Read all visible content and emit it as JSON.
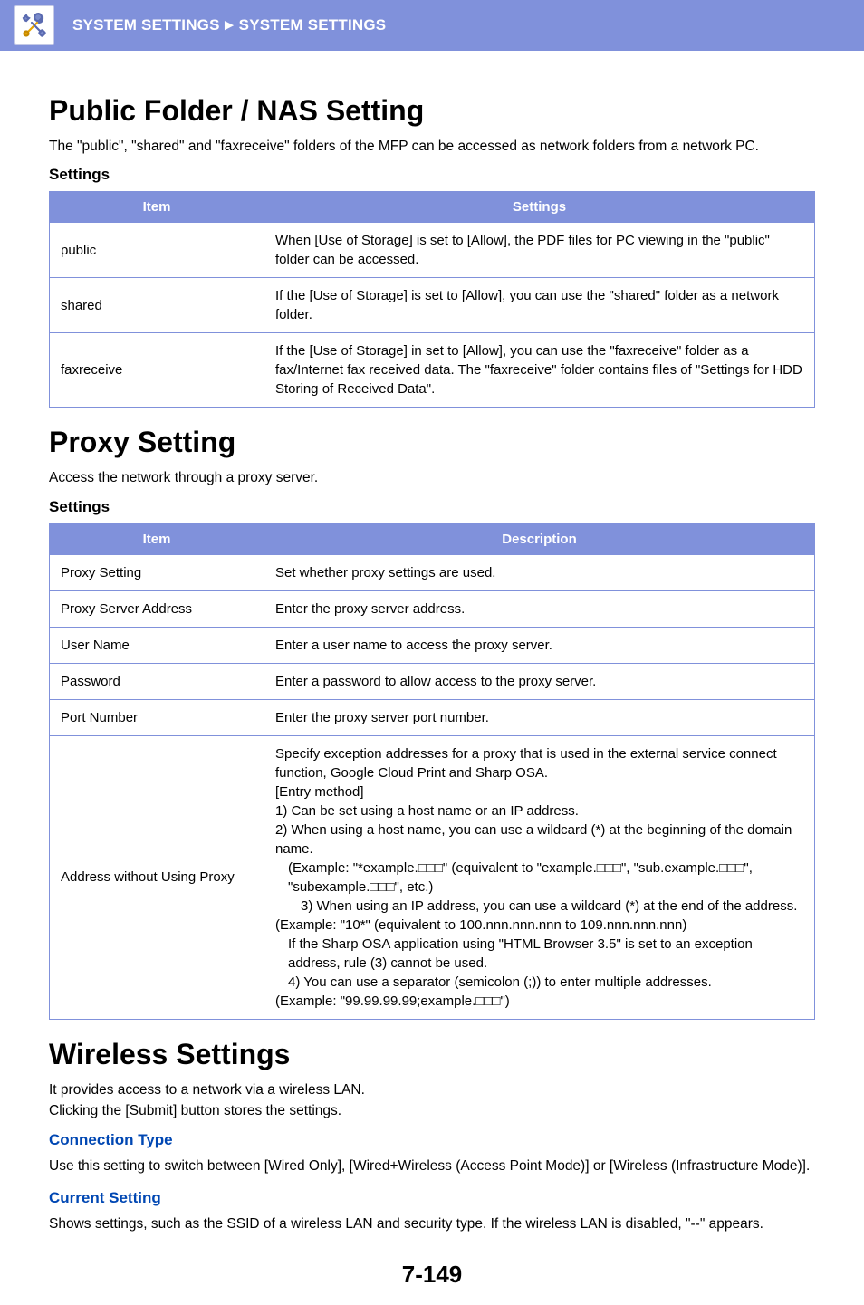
{
  "header": {
    "breadcrumb1": "SYSTEM SETTINGS",
    "sep": "►",
    "breadcrumb2": "SYSTEM SETTINGS"
  },
  "section1": {
    "title": "Public Folder / NAS Setting",
    "intro": "The \"public\", \"shared\" and \"faxreceive\" folders of the MFP can be accessed as network folders from a network PC.",
    "subhead": "Settings",
    "table": {
      "col1": "Item",
      "col2": "Settings",
      "rows": [
        {
          "item": "public",
          "desc": "When [Use of Storage] is set to [Allow], the PDF files for PC viewing in the \"public\" folder can be accessed."
        },
        {
          "item": "shared",
          "desc": "If the [Use of Storage] is set to [Allow], you can use the \"shared\" folder as a network folder."
        },
        {
          "item": "faxreceive",
          "desc": "If the [Use of Storage] in set to [Allow], you can use the \"faxreceive\" folder as a fax/Internet fax received data. The \"faxreceive\" folder contains files of \"Settings for HDD Storing of Received Data\"."
        }
      ]
    }
  },
  "section2": {
    "title": "Proxy Setting",
    "intro": "Access the network through a proxy server.",
    "subhead": "Settings",
    "table": {
      "col1": "Item",
      "col2": "Description",
      "rows": [
        {
          "item": "Proxy Setting",
          "desc_lines": [
            "Set whether proxy settings are used."
          ]
        },
        {
          "item": "Proxy Server Address",
          "desc_lines": [
            "Enter the proxy server address."
          ]
        },
        {
          "item": "User Name",
          "desc_lines": [
            "Enter a user name to access the proxy server."
          ]
        },
        {
          "item": "Password",
          "desc_lines": [
            "Enter a password to allow access to the proxy server."
          ]
        },
        {
          "item": "Port Number",
          "desc_lines": [
            "Enter the proxy server port number."
          ]
        },
        {
          "item": "Address without Using Proxy",
          "desc_lines": [
            "Specify exception addresses for a proxy that is used in the external service connect function, Google Cloud Print and Sharp OSA.",
            "[Entry method]",
            "1) Can be set using a host name or an IP address.",
            "2) When using a host name, you can use a wildcard (*) at the beginning of the domain name.",
            "(Example: \"*example.□□□\" (equivalent to \"example.□□□\", \"sub.example.□□□\", \"subexample.□□□\", etc.)",
            "3) When using an IP address, you can use a wildcard (*) at the end of the address.",
            "(Example: \"10*\" (equivalent to 100.nnn.nnn.nnn to 109.nnn.nnn.nnn)",
            "If the Sharp OSA application using \"HTML Browser 3.5\" is set to an exception address, rule (3) cannot be used.",
            "4) You can use a separator (semicolon (;)) to enter multiple addresses.",
            "(Example: \"99.99.99.99;example.□□□\")"
          ],
          "indents": [
            0,
            0,
            0,
            0,
            1,
            2,
            0,
            1,
            1,
            0,
            1
          ]
        }
      ]
    }
  },
  "section3": {
    "title": "Wireless Settings",
    "intro1": "It provides access to a network via a wireless LAN.",
    "intro2": "Clicking the [Submit] button stores the settings.",
    "sub1_title": "Connection Type",
    "sub1_text": "Use this setting to switch between [Wired Only], [Wired+Wireless (Access Point Mode)] or [Wireless (Infrastructure Mode)].",
    "sub2_title": "Current Setting",
    "sub2_text": "Shows settings, such as the SSID of a wireless LAN and security type. If the wireless LAN is disabled, \"--\" appears."
  },
  "pageNumber": "7-149"
}
